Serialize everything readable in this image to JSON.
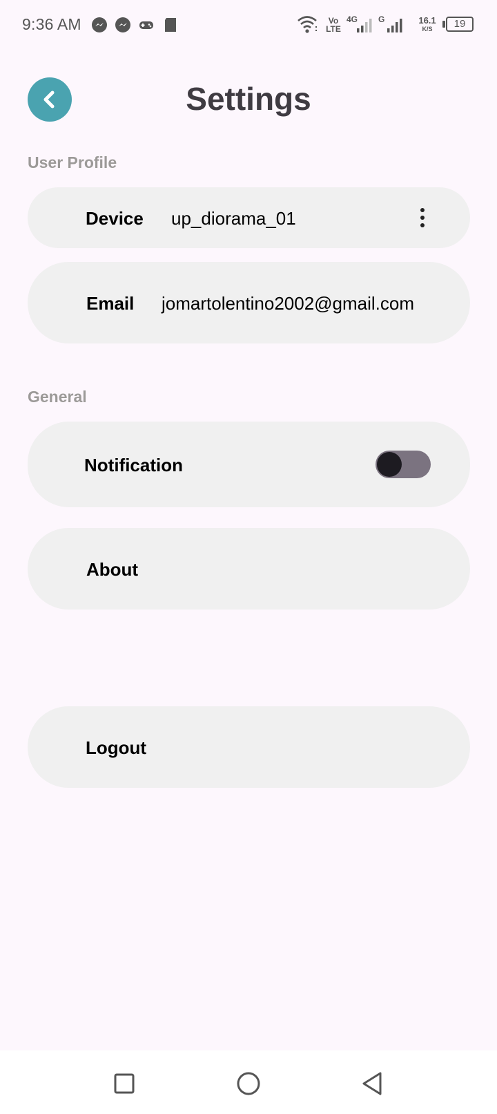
{
  "status_bar": {
    "time": "9:36 AM",
    "icons_left": [
      "messenger-icon",
      "messenger-icon",
      "gamepad-icon",
      "sd-card-icon"
    ],
    "icons_right": [
      "wifi-icon",
      "volte-icon",
      "signal-4g-icon",
      "signal-g-icon"
    ],
    "volte_top": "Vo",
    "volte_bottom": "LTE",
    "net_4g": "4G",
    "net_g": "G",
    "speed_value": "16.1",
    "speed_unit": "K/S",
    "battery": "19"
  },
  "header": {
    "title": "Settings",
    "back_icon": "chevron-left-icon",
    "accent_color": "#4aa3b0"
  },
  "sections": {
    "user_profile": "User Profile",
    "general": "General"
  },
  "device": {
    "label": "Device",
    "value": "up_diorama_01",
    "menu_icon": "more-vertical-icon"
  },
  "email": {
    "label": "Email",
    "value": "jomartolentino2002@gmail.com"
  },
  "notification": {
    "label": "Notification",
    "enabled": false
  },
  "about": {
    "label": "About"
  },
  "logout": {
    "label": "Logout"
  },
  "nav_bar": {
    "items": [
      "recent-apps-icon",
      "home-icon",
      "back-icon"
    ]
  }
}
